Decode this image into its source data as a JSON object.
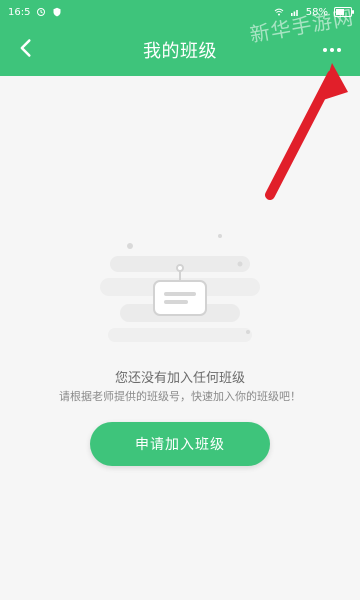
{
  "status_bar": {
    "time": "16:5",
    "battery": "58%"
  },
  "header": {
    "title": "我的班级",
    "watermark": "新华手游网"
  },
  "empty_state": {
    "title": "您还没有加入任何班级",
    "subtitle": "请根据老师提供的班级号，快速加入你的班级吧！"
  },
  "actions": {
    "join_label": "申请加入班级"
  },
  "colors": {
    "primary": "#3ec47b",
    "arrow": "#e11f2a"
  },
  "icons": {
    "back": "back-chevron-icon",
    "more": "more-dots-icon",
    "empty": "empty-class-card-illustration"
  }
}
